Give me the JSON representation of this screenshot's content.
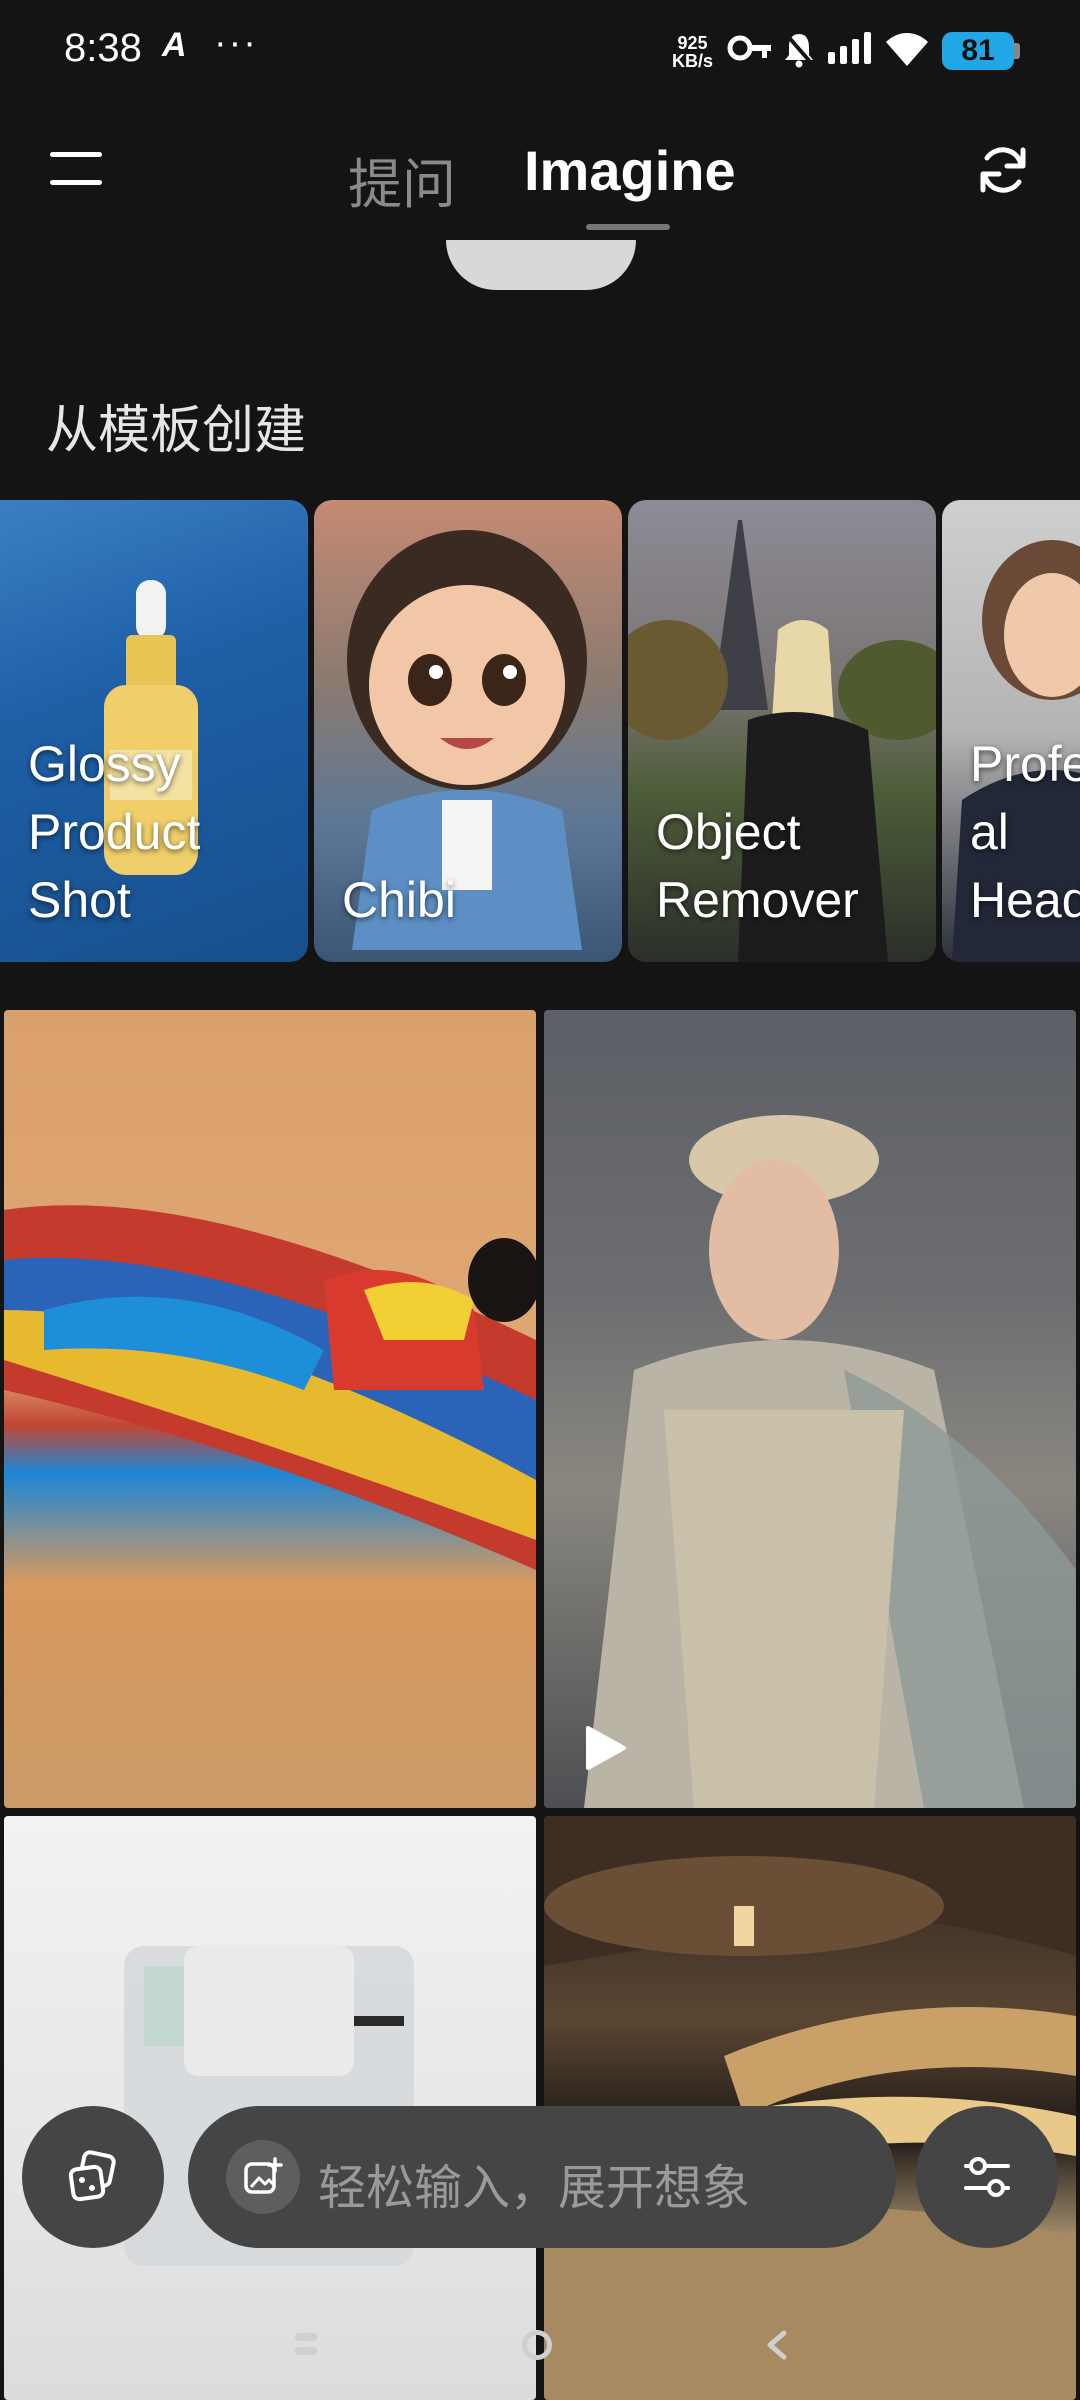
{
  "status_bar": {
    "time": "8:38",
    "app_indicator": "A",
    "more": "···",
    "speed_value": "925",
    "speed_unit": "KB/s",
    "battery": "81"
  },
  "header": {
    "tabs": [
      {
        "label": "提问",
        "active": false
      },
      {
        "label": "Imagine",
        "active": true
      }
    ]
  },
  "section": {
    "title": "从模板创建"
  },
  "templates": [
    {
      "label_lines": [
        "Glossy",
        "Product",
        "Shot"
      ]
    },
    {
      "label_lines": [
        "Chibi"
      ]
    },
    {
      "label_lines": [
        "Object",
        "Remover"
      ]
    },
    {
      "label_lines": [
        "Profe",
        "al",
        "Head"
      ]
    }
  ],
  "prompt": {
    "placeholder": "轻松输入，展开想象"
  },
  "icons": {
    "menu": "menu-icon",
    "refresh": "refresh-icon",
    "play": "play-icon",
    "gallery": "gallery-stack-icon",
    "add_image": "add-image-icon",
    "settings": "sliders-icon"
  },
  "colors": {
    "background": "#141414",
    "battery": "#22a7e6",
    "control": "#454545"
  }
}
